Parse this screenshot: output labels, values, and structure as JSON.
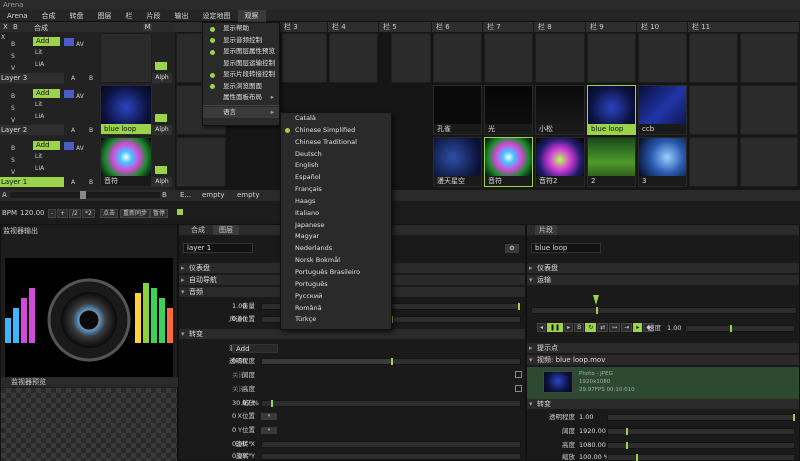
{
  "app": {
    "title": "Arena"
  },
  "menu": [
    "Arena",
    "合成",
    "转盘",
    "图层",
    "栏",
    "片段",
    "输出",
    "设定地图",
    "观察"
  ],
  "header": {
    "x": "X",
    "b": "B",
    "comp": "合成",
    "m": "M"
  },
  "columns": [
    "栏 3",
    "栏 4",
    "栏 5",
    "栏 6",
    "栏 7",
    "栏 8",
    "栏 9",
    "栏 10",
    "栏 11"
  ],
  "layers": [
    {
      "name": "Layer 3",
      "blend": "Add",
      "lit": "Lit",
      "lia": "LIA",
      "a": "A",
      "b": "B",
      "alph": "Alph",
      "clip_label": ""
    },
    {
      "name": "Layer 2",
      "blend": "Add",
      "lit": "Lit",
      "lia": "LIA",
      "a": "A",
      "b": "B",
      "alph": "Alph",
      "clip_label": "blue loop"
    },
    {
      "name": "Layer 1",
      "blend": "Add",
      "lit": "Lit",
      "lia": "LIA",
      "a": "A",
      "b": "B",
      "alph": "Alph",
      "clip_label": "音符"
    }
  ],
  "layer_controls": {
    "x": "X",
    "b": "B",
    "s": "S",
    "av": "AV",
    "v": "V"
  },
  "clips_row2": [
    "孔雀",
    "光",
    "小松",
    "blue loop",
    "ccb"
  ],
  "clips_row3": [
    "漫天星空",
    "音符",
    "音符2",
    "2",
    "3"
  ],
  "deck": {
    "a": "A",
    "b": "B",
    "e": "E...",
    "empty1": "empty",
    "empty2": "empty"
  },
  "bpm": {
    "label": "BPM",
    "value": "120.00",
    "minus": "-",
    "plus": "+",
    "half": "/2",
    "double": "*2",
    "tap": "点击",
    "resync": "重新同步",
    "pause": "暂停"
  },
  "view_menu": {
    "items": [
      {
        "label": "显示帮助",
        "checked": true
      },
      {
        "label": "显示音频控制",
        "checked": true
      },
      {
        "label": "显示图层属性预览",
        "checked": true
      },
      {
        "label": "显示图层运输控制",
        "checked": false
      },
      {
        "label": "显示片段转接控制",
        "checked": true
      },
      {
        "label": "显示浏览图面",
        "checked": true
      },
      {
        "label": "属性面板布局",
        "checked": false,
        "submenu": true
      },
      {
        "label": "语言",
        "checked": false,
        "submenu": true
      }
    ]
  },
  "language_menu": {
    "items": [
      "Català",
      "Chinese Simplified",
      "Chinese Traditional",
      "Deutsch",
      "English",
      "Español",
      "Français",
      "Haags",
      "Italiano",
      "Japanese",
      "Magyar",
      "Nederlands",
      "Norsk Bokmål",
      "Português Brasileiro",
      "Português",
      "Русский",
      "Română",
      "Türkçe"
    ],
    "selected": "Chinese Simplified"
  },
  "monitor": {
    "output_title": "监视器输出",
    "preview_title": "监视器预览"
  },
  "layer_props": {
    "tabs": [
      "合成",
      "图层"
    ],
    "layer_name": "layer 1",
    "sections": {
      "dashboard": "仪表盘",
      "autopilot": "自动导航",
      "audio": "音频",
      "transform": "转变"
    },
    "volume_label": "音量",
    "volume_value": "1.00",
    "pan_label": "声道位置",
    "pan_value": "0.00",
    "blend_label": "混合模式",
    "blend_value": "Add",
    "opacity_label": "透明程度",
    "opacity_value": "0.50",
    "width_label": "阔度",
    "width_value": "关闭",
    "height_label": "高度",
    "height_value": "关闭",
    "scale_label": "缩放",
    "scale_value": "30.97 %",
    "posx_label": "X位置",
    "posx_value": "0",
    "posy_label": "Y位置",
    "posy_value": "0",
    "rotx_label": "旋转 X",
    "rotx_value": "0.00 °",
    "roty_label": "旋转 Y",
    "roty_value": "0.00 °"
  },
  "clip_props": {
    "tab": "片段",
    "clip_name": "blue loop",
    "sections": {
      "dashboard": "仪表盘",
      "transport": "运输",
      "cue": "提示点",
      "video": "视频: blue loop.mov",
      "transform": "转变"
    },
    "speed_label": "速度",
    "speed_value": "1.00",
    "video_info": [
      "Photo - JPEG",
      "1920x1080",
      "29.97FPS 00:10:010"
    ],
    "opacity_label": "透明程度",
    "opacity_value": "1.00",
    "width_label": "阔度",
    "width_value": "1920.00",
    "height_label": "高度",
    "height_value": "1080.00",
    "scale_label": "缩放",
    "scale_value": "100.00 %"
  },
  "colors": {
    "accent": "#9bd34a",
    "background": "#1b1b1b",
    "panel": "#222222"
  }
}
